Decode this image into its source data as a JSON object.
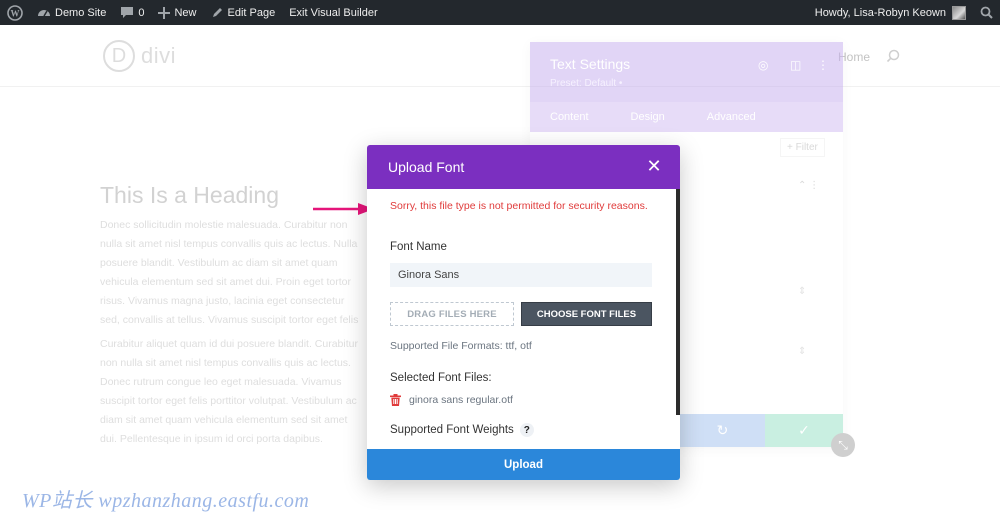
{
  "admin_bar": {
    "site_name": "Demo Site",
    "comments_count": "0",
    "new_label": "New",
    "edit_page_label": "Edit Page",
    "exit_builder_label": "Exit Visual Builder",
    "greeting": "Howdy, Lisa-Robyn Keown"
  },
  "site": {
    "logo_letter": "D",
    "logo_text": "divi",
    "nav_home": "Home"
  },
  "page": {
    "heading": "This Is a Heading",
    "paragraph1": "Donec sollicitudin molestie malesuada. Curabitur non nulla sit amet nisl tempus convallis quis ac lectus. Nulla posuere blandit. Vestibulum ac diam sit amet quam vehicula elementum sed sit amet dui. Proin eget tortor risus. Vivamus magna justo, lacinia eget consectetur sed, convallis at tellus. Vivamus suscipit tortor eget felis porttitor volutpat. Pellentesque in ipsum id orci porta dapibus. Curabitur aliquet quam id dui posuere blandit. Mauris blandit aliquet elit, eget tincidunt nibh pulvinar a. Quisque velit nisi, pretium ut lacinia in, elementum id enim. Nulla porttitor accumsan tincidunt. Vestibulum ante ipsum primis in faucibus orci luctus et ultrices posuere cubilia Curae; Donec velit neque, auctor sit amet aliquam vel, ullamcorper sit amet ligula. Vivamus suscipit tortor eget felis porttitor volutpat. Proin eget tortor risus. Curabitur non nulla sit amet nisl tempus convallis quis ac lectus. Donec rutrum congue leo eget malesuada. a pellentesque nec, egestas non nisi. Vestibulum ac diam sit amet quam vehicula elementum sed sit amet dui. pellentesque nec, egestas non nisi. Pellentesque in ipsum id orci porta dapibus. porttitor volutpat.",
    "paragraph2": "Curabitur aliquet quam id dui posuere blandit. Curabitur non nulla sit amet nisl tempus convallis quis ac lectus. Donec rutrum congue leo eget malesuada. Vivamus suscipit tortor eget felis porttitor volutpat. Vestibulum ac diam sit amet quam vehicula elementum sed sit amet dui. Pellentesque in ipsum id orci porta dapibus. Vivamus magna justo, lacinia eget consectetur sed, convallis at tellus. Nulla quis lorem ut libero malesuada feugiat. Quisque velit nisi, pretium ut lacinia in, elementum id enim. felis porttitor volutpat."
  },
  "text_settings": {
    "title": "Text Settings",
    "preset": "Preset: Default •",
    "tabs": [
      "Content",
      "Design",
      "Advanced"
    ],
    "filter_label": "+ Filter"
  },
  "modal": {
    "title": "Upload Font",
    "error": "Sorry, this file type is not permitted for security reasons.",
    "font_name_label": "Font Name",
    "font_name_value": "Ginora Sans",
    "drag_label": "DRAG FILES HERE",
    "choose_label": "CHOOSE FONT FILES",
    "supported_formats": "Supported File Formats: ttf, otf",
    "selected_label": "Selected Font Files:",
    "selected_file": "ginora sans regular.otf",
    "weights_label": "Supported Font Weights",
    "upload_label": "Upload"
  },
  "watermark": "WP站长  wpzhanzhang.eastfu.com",
  "colors": {
    "admin_bar": "#23282d",
    "modal_header": "#7b2fc0",
    "upload_button": "#2b87da",
    "error_text": "#e03b3b",
    "arrow": "#e5157a"
  }
}
